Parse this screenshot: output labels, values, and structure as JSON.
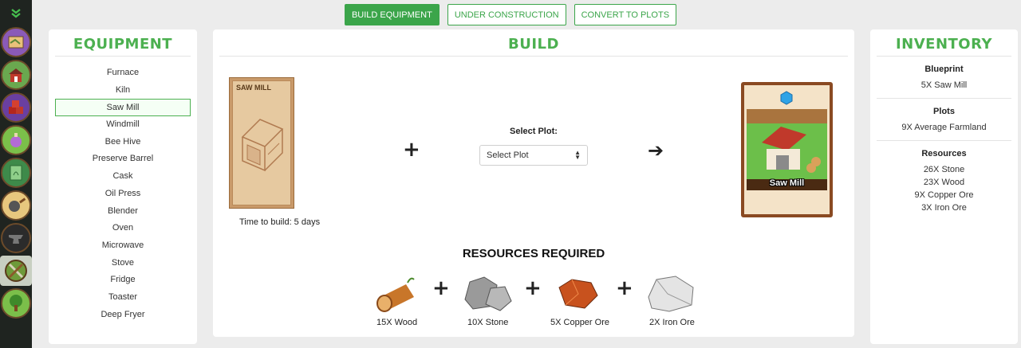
{
  "sidebar": {
    "icons": [
      "expand-chevrons-icon",
      "map-icon",
      "barn-icon",
      "crates-icon",
      "potion-icon",
      "seed-packet-icon",
      "cooking-pan-icon",
      "anvil-icon",
      "crossed-tools-icon",
      "tree-icon"
    ]
  },
  "topbar": {
    "build_equipment": "BUILD EQUIPMENT",
    "under_construction": "UNDER CONSTRUCTION",
    "convert_to_plots": "CONVERT TO PLOTS"
  },
  "equipment": {
    "title": "EQUIPMENT",
    "items": [
      "Furnace",
      "Kiln",
      "Saw Mill",
      "Windmill",
      "Bee Hive",
      "Preserve Barrel",
      "Cask",
      "Oil Press",
      "Blender",
      "Oven",
      "Microwave",
      "Stove",
      "Fridge",
      "Toaster",
      "Deep Fryer"
    ],
    "selected": "Saw Mill"
  },
  "build": {
    "title": "BUILD",
    "card_title": "SAW MILL",
    "time_to_build": "Time to build: 5 days",
    "select_plot_label": "Select Plot:",
    "select_plot_value": "Select Plot",
    "result_card_label": "Saw Mill",
    "resources_title": "RESOURCES REQUIRED",
    "resources": [
      {
        "label": "15X Wood",
        "icon": "wood-log-icon"
      },
      {
        "label": "10X Stone",
        "icon": "stone-icon"
      },
      {
        "label": "5X Copper Ore",
        "icon": "copper-ore-icon"
      },
      {
        "label": "2X Iron Ore",
        "icon": "iron-ore-icon"
      }
    ]
  },
  "inventory": {
    "title": "INVENTORY",
    "blueprint_head": "Blueprint",
    "blueprint_items": [
      "5X Saw Mill"
    ],
    "plots_head": "Plots",
    "plots_items": [
      "9X Average Farmland"
    ],
    "resources_head": "Resources",
    "resources_items": [
      "26X Stone",
      "23X Wood",
      "9X Copper Ore",
      "3X Iron Ore"
    ]
  },
  "colors": {
    "accent": "#4cb050",
    "button": "#3ba54a",
    "rail": "#1f2420"
  }
}
